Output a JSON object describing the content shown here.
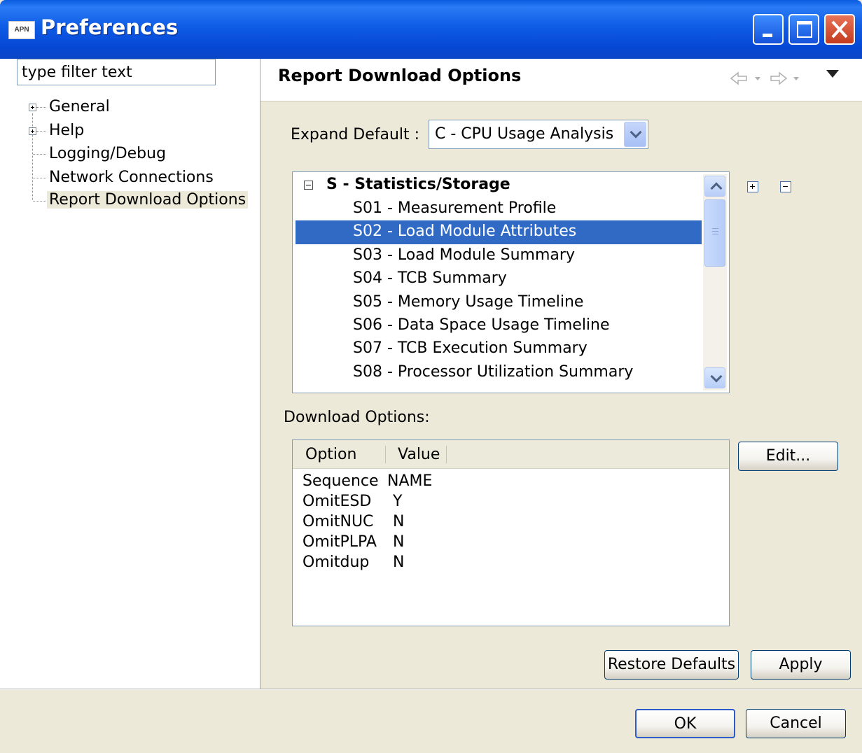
{
  "window": {
    "icon_text": "APN",
    "title": "Preferences"
  },
  "filter": {
    "value": "type filter text"
  },
  "tree": {
    "items": [
      {
        "label": "General",
        "expandable": true
      },
      {
        "label": "Help",
        "expandable": true
      },
      {
        "label": "Logging/Debug",
        "expandable": false
      },
      {
        "label": "Network Connections",
        "expandable": false
      },
      {
        "label": "Report Download Options",
        "expandable": false,
        "selected": true
      }
    ]
  },
  "page": {
    "title": "Report Download Options"
  },
  "expand_default": {
    "label": "Expand Default :",
    "value": "C - CPU Usage Analysis"
  },
  "report_list": {
    "group": "S - Statistics/Storage",
    "items": [
      "S01 - Measurement Profile",
      "S02 - Load Module Attributes",
      "S03 - Load Module Summary",
      "S04 - TCB Summary",
      "S05 - Memory Usage Timeline",
      "S06 - Data Space Usage Timeline",
      "S07 - TCB Execution Summary",
      "S08 - Processor Utilization Summary"
    ],
    "selected_index": 1
  },
  "download_options": {
    "label": "Download Options:",
    "columns": [
      "Option",
      "Value"
    ],
    "rows": [
      {
        "option": "Sequence",
        "value": "NAME"
      },
      {
        "option": "OmitESD",
        "value": "Y"
      },
      {
        "option": "OmitNUC",
        "value": "N"
      },
      {
        "option": "OmitPLPA",
        "value": "N"
      },
      {
        "option": "Omitdup",
        "value": "N"
      }
    ]
  },
  "buttons": {
    "edit": "Edit...",
    "restore_defaults": "Restore Defaults",
    "apply": "Apply",
    "ok": "OK",
    "cancel": "Cancel"
  },
  "colors": {
    "selection": "#316AC5",
    "titlebar": "#0A5BE0",
    "dialog_bg": "#ECE9D8"
  }
}
